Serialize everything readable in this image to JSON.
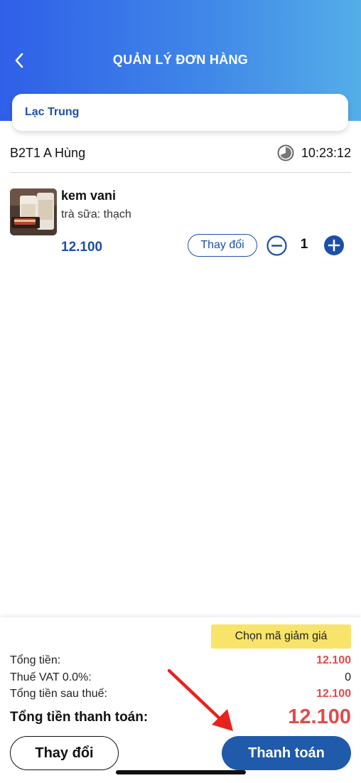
{
  "header": {
    "title": "QUẢN LÝ ĐƠN HÀNG",
    "back_icon": "chevron-left-icon",
    "gradient": [
      "#2f5fe8",
      "#54aee8"
    ]
  },
  "store": {
    "name": "Lạc Trung"
  },
  "table": {
    "label": "B2T1  A Hùng",
    "time": "10:23:12",
    "clock_icon": "clock-icon"
  },
  "items": [
    {
      "name": "kem vani",
      "option": "trà sữa: thạch",
      "price": "12.100",
      "change_label": "Thay đổi",
      "quantity": "1"
    }
  ],
  "summary": {
    "coupon_label": "Chọn mã giảm giá",
    "total_label": "Tổng tiền:",
    "total_value": "12.100",
    "vat_label": "Thuế VAT 0.0%:",
    "vat_value": "0",
    "after_tax_label": "Tổng tiền sau thuế:",
    "after_tax_value": "12.100",
    "grand_label": "Tổng tiền thanh toán:",
    "grand_value": "12.100"
  },
  "actions": {
    "change_label": "Thay đổi",
    "pay_label": "Thanh toán"
  },
  "colors": {
    "primary": "#1f5aab",
    "accent_red": "#e24a4a",
    "coupon_bg": "#f8e46a",
    "annotation_arrow": "#e8231e"
  }
}
